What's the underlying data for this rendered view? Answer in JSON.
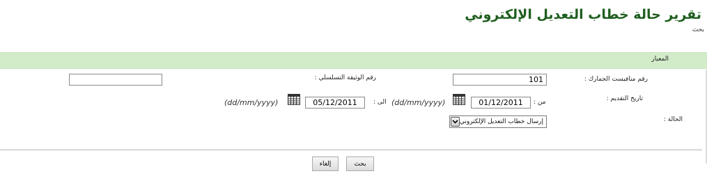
{
  "page": {
    "title": "تقرير حالة خطاب التعديل الإلكتروني",
    "subtitle": "بحث"
  },
  "criteria": {
    "header": "المعيار"
  },
  "form": {
    "manifest_label": "رقم منافيست الجمارك :",
    "manifest_value": "101",
    "serial_label": "رقم الوثيقة التسلسلي :",
    "serial_value": "",
    "submit_date_label": "تاريخ التقديم :",
    "from_label": "من :",
    "from_value": "01/12/2011",
    "from_hint": "(dd/mm/yyyy)",
    "to_label": "الى :",
    "to_value": "05/12/2011",
    "to_hint": "(dd/mm/yyyy)",
    "status_label": "الحالة :",
    "status_selected": "إرسال خطاب التعديل الإلكتروني"
  },
  "buttons": {
    "search": "بحث",
    "cancel": "إلغاء"
  },
  "icons": {
    "calendar": "calendar-icon",
    "dropdown": "chevron-down-icon"
  },
  "colors": {
    "title": "#1f5e1f",
    "criteria_bar": "#d2ecca"
  }
}
